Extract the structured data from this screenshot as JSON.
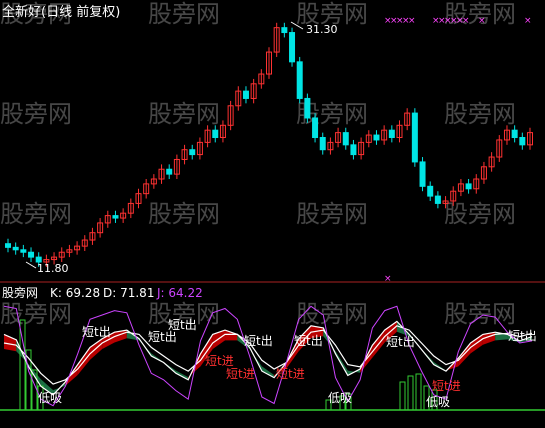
{
  "title": "全新好(日线 前复权)",
  "watermark": "股旁网",
  "price_panel": {
    "high_label": "31.30",
    "low_label": "11.80"
  },
  "indicator_panel": {
    "name": "股旁网",
    "k_label": "K: 69.28",
    "d_label": "D: 71.81",
    "j_label": "J: 64.22",
    "signal_out": "短t出",
    "signal_in": "短t进",
    "signal_low": "低吸"
  },
  "colors": {
    "background": "#000000",
    "up": "#ff3232",
    "down": "#00e5e5",
    "k_line": "#ffffff",
    "d_line": "#ffffff",
    "j_line": "#cc44ff",
    "green": "#33cc33",
    "red_band": "#cc0000",
    "dark_green_band": "#1e7a4a",
    "signal_red": "#ff3030",
    "marker": "#ff44ff"
  },
  "chart_data": [
    {
      "type": "candlestick",
      "title": "全新好(日线 前复权)",
      "annotations": [
        "31.30",
        "11.80"
      ],
      "closes": [
        13.0,
        12.8,
        12.6,
        12.2,
        11.8,
        12.0,
        12.2,
        12.6,
        12.8,
        13.1,
        13.6,
        14.2,
        15.0,
        15.6,
        15.4,
        15.8,
        16.6,
        17.4,
        18.2,
        18.6,
        19.4,
        19.0,
        20.2,
        21.0,
        20.6,
        21.6,
        22.6,
        22.0,
        23.0,
        24.6,
        25.8,
        25.2,
        26.4,
        27.2,
        29.0,
        31.0,
        30.6,
        28.2,
        25.2,
        23.6,
        22.0,
        21.0,
        21.6,
        22.4,
        21.4,
        20.6,
        21.6,
        22.2,
        21.8,
        22.6,
        22.0,
        23.0,
        24.0,
        20.0,
        18.0,
        17.2,
        16.6,
        16.8,
        17.6,
        18.2,
        17.8,
        18.6,
        19.6,
        20.4,
        21.8,
        22.6,
        22.0,
        21.4,
        22.4
      ],
      "direction": [
        "down",
        "down",
        "down",
        "down",
        "down",
        "up",
        "up",
        "up",
        "up",
        "up",
        "up",
        "up",
        "up",
        "up",
        "down",
        "up",
        "up",
        "up",
        "up",
        "up",
        "up",
        "down",
        "up",
        "up",
        "down",
        "up",
        "up",
        "down",
        "up",
        "up",
        "up",
        "down",
        "up",
        "up",
        "up",
        "up",
        "down",
        "down",
        "down",
        "down",
        "down",
        "down",
        "up",
        "up",
        "down",
        "down",
        "up",
        "up",
        "down",
        "up",
        "down",
        "up",
        "up",
        "down",
        "down",
        "down",
        "down",
        "up",
        "up",
        "up",
        "down",
        "up",
        "up",
        "up",
        "up",
        "up",
        "down",
        "down",
        "up"
      ]
    },
    {
      "type": "line",
      "name": "股旁网",
      "series": [
        {
          "name": "K",
          "values": [
            70,
            65,
            40,
            22,
            14,
            26,
            42,
            58,
            66,
            72,
            74,
            66,
            50,
            44,
            34,
            28,
            52,
            70,
            74,
            70,
            58,
            36,
            30,
            44,
            66,
            78,
            76,
            52,
            32,
            38,
            60,
            74,
            82,
            70,
            56,
            42,
            36,
            48,
            62,
            70,
            72,
            70,
            64,
            68
          ]
        },
        {
          "name": "D",
          "values": [
            62,
            60,
            48,
            34,
            24,
            28,
            38,
            52,
            62,
            68,
            72,
            70,
            58,
            50,
            42,
            36,
            46,
            62,
            70,
            70,
            62,
            46,
            38,
            44,
            60,
            72,
            74,
            60,
            42,
            40,
            54,
            68,
            78,
            74,
            62,
            50,
            42,
            46,
            58,
            66,
            70,
            71,
            68,
            71
          ]
        },
        {
          "name": "J",
          "values": [
            96,
            94,
            36,
            10,
            4,
            22,
            52,
            84,
            88,
            92,
            90,
            60,
            34,
            28,
            18,
            10,
            64,
            90,
            94,
            84,
            50,
            12,
            6,
            44,
            84,
            96,
            88,
            30,
            8,
            28,
            76,
            92,
            96,
            60,
            36,
            14,
            10,
            54,
            80,
            88,
            86,
            72,
            62,
            64
          ]
        }
      ]
    }
  ]
}
